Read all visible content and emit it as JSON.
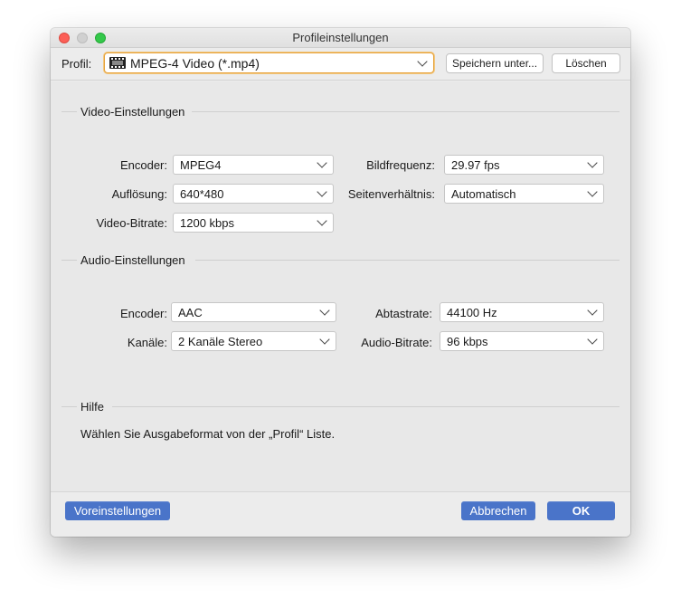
{
  "window": {
    "title": "Profileinstellungen"
  },
  "profile": {
    "label": "Profil:",
    "value": "MPEG-4 Video (*.mp4)",
    "icon": "film-icon",
    "save_label": "Speichern unter...",
    "delete_label": "Löschen"
  },
  "video": {
    "title": "Video-Einstellungen",
    "encoder_label": "Encoder:",
    "encoder_value": "MPEG4",
    "framerate_label": "Bildfrequenz:",
    "framerate_value": "29.97 fps",
    "resolution_label": "Auflösung:",
    "resolution_value": "640*480",
    "aspect_label": "Seitenverhältnis:",
    "aspect_value": "Automatisch",
    "bitrate_label": "Video-Bitrate:",
    "bitrate_value": "1200 kbps"
  },
  "audio": {
    "title": "Audio-Einstellungen",
    "encoder_label": "Encoder:",
    "encoder_value": "AAC",
    "samplerate_label": "Abtastrate:",
    "samplerate_value": "44100 Hz",
    "channels_label": "Kanäle:",
    "channels_value": "2 Kanäle Stereo",
    "bitrate_label": "Audio-Bitrate:",
    "bitrate_value": "96 kbps"
  },
  "help": {
    "title": "Hilfe",
    "text": "Wählen Sie Ausgabeformat von der „Profil“ Liste."
  },
  "footer": {
    "presets_label": "Voreinstellungen",
    "cancel_label": "Abbrechen",
    "ok_label": "OK"
  },
  "colors": {
    "primary_button": "#4a74c9",
    "focus_ring": "#e6a23a",
    "close": "#fc5f57",
    "maximize": "#34c84a"
  }
}
